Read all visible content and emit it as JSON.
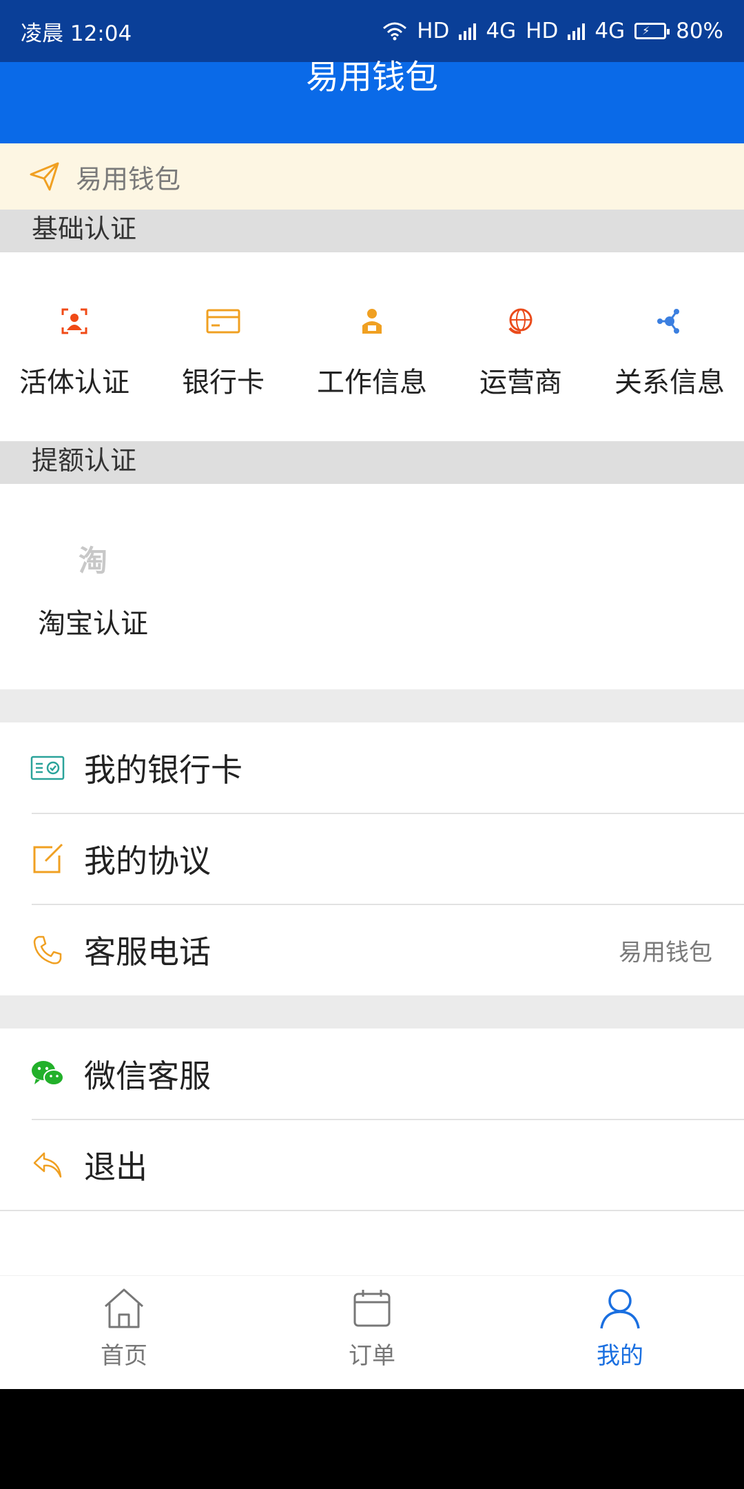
{
  "status": {
    "time": "凌晨 12:04",
    "hd1": "HD",
    "net1": "4G",
    "hd2": "HD",
    "net2": "4G",
    "battery": "80%"
  },
  "header": {
    "title": "易用钱包"
  },
  "notice": {
    "text": "易用钱包"
  },
  "basic_auth": {
    "title": "基础认证",
    "items": [
      {
        "label": "活体认证",
        "icon": "face-verify-icon"
      },
      {
        "label": "银行卡",
        "icon": "bank-card-icon"
      },
      {
        "label": "工作信息",
        "icon": "work-person-icon"
      },
      {
        "label": "运营商",
        "icon": "globe-carrier-icon"
      },
      {
        "label": "关系信息",
        "icon": "relation-nodes-icon"
      }
    ]
  },
  "limit_auth": {
    "title": "提额认证",
    "items": [
      {
        "label": "淘宝认证",
        "icon_text": "淘"
      }
    ]
  },
  "menu": {
    "bank_cards": "我的银行卡",
    "agreements": "我的协议",
    "service_phone": "客服电话",
    "service_phone_value": "易用钱包",
    "wechat_service": "微信客服",
    "logout": "退出"
  },
  "tabs": [
    {
      "label": "首页"
    },
    {
      "label": "订单"
    },
    {
      "label": "我的"
    }
  ],
  "colors": {
    "primary": "#0a6ae8",
    "statusbar": "#0a3f98",
    "accent_orange": "#f0a022",
    "active_tab": "#1a6fe0"
  }
}
